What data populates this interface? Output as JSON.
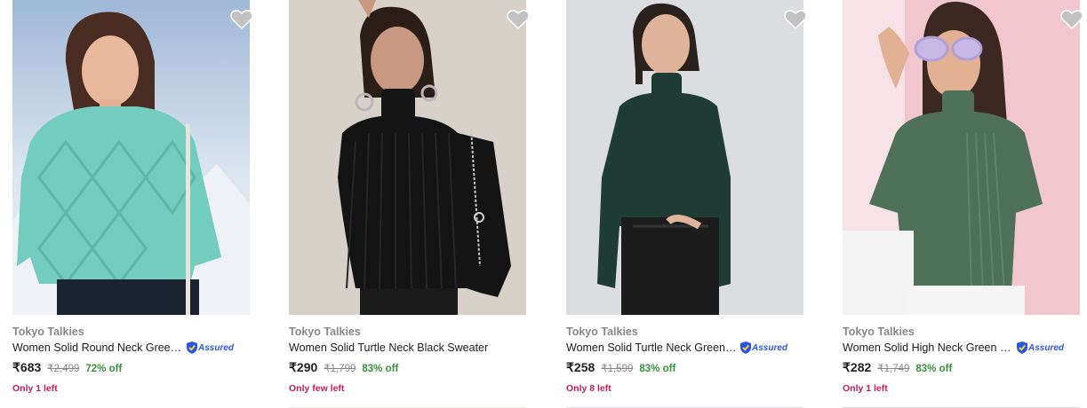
{
  "products": [
    {
      "brand": "Tokyo Talkies",
      "title": "Women Solid Round Neck Green Sweater",
      "assured": true,
      "assured_label": "Assured",
      "price": "₹683",
      "mrp": "₹2,499",
      "discount": "72% off",
      "stock": "Only 1 left",
      "colors": {
        "sweater": "#72cdbe",
        "bg": "#c7d9e8"
      }
    },
    {
      "brand": "Tokyo Talkies",
      "title": "Women Solid Turtle Neck Black Sweater",
      "assured": false,
      "assured_label": "",
      "price": "₹290",
      "mrp": "₹1,799",
      "discount": "83% off",
      "stock": "Only few left",
      "colors": {
        "sweater": "#141414",
        "bg": "#d8d1ca"
      }
    },
    {
      "brand": "Tokyo Talkies",
      "title": "Women Solid Turtle Neck Green Sweater",
      "assured": true,
      "assured_label": "Assured",
      "price": "₹258",
      "mrp": "₹1,599",
      "discount": "83% off",
      "stock": "Only 8 left",
      "colors": {
        "sweater": "#1e3c33",
        "bg": "#dcdde0"
      }
    },
    {
      "brand": "Tokyo Talkies",
      "title": "Women Solid High Neck Green Sweater",
      "assured": true,
      "assured_label": "Assured",
      "price": "₹282",
      "mrp": "₹1,749",
      "discount": "83% off",
      "stock": "Only 1 left",
      "colors": {
        "sweater": "#4f7059",
        "bg": "#f1c6cf"
      }
    }
  ],
  "colors": {
    "price": "#212121",
    "discount": "#388e3c",
    "stock": "#c91a5b",
    "assured": "#2a55e5",
    "heart": "#c2c2c2"
  },
  "icons": {
    "wishlist": "heart-icon",
    "assured": "assured-shield-icon"
  }
}
